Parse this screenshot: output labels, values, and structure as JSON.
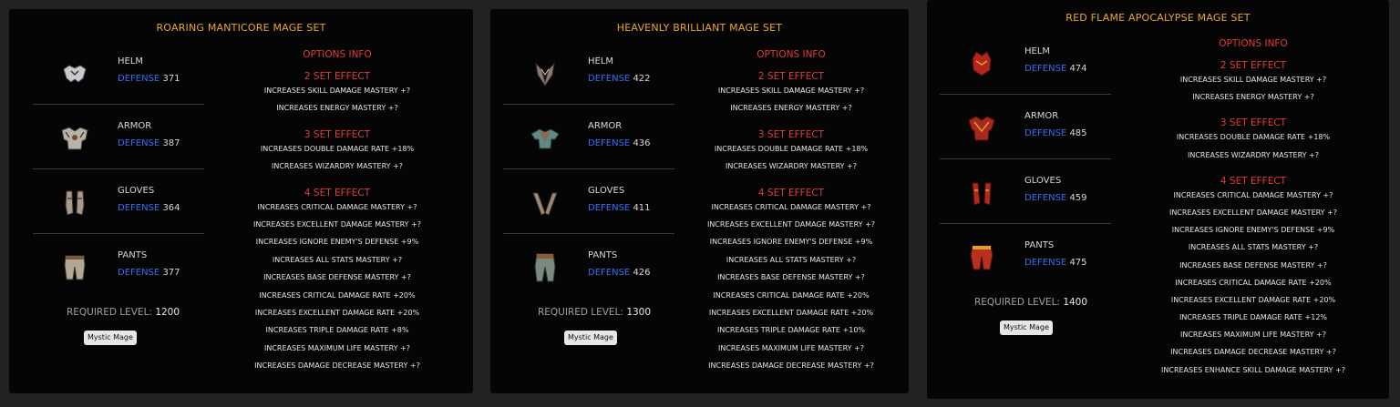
{
  "labels": {
    "options_info": "OPTIONS INFO",
    "defense": "DEFENSE",
    "required_level": "REQUIRED LEVEL:"
  },
  "sets": [
    {
      "title": "ROARING MANTICORE MAGE SET",
      "required_level": "1200",
      "class_tag": "Mystic Mage",
      "items": [
        {
          "name": "HELM",
          "defense": "371"
        },
        {
          "name": "ARMOR",
          "defense": "387"
        },
        {
          "name": "GLOVES",
          "defense": "364"
        },
        {
          "name": "PANTS",
          "defense": "377"
        }
      ],
      "effects": {
        "set2_title": "2 SET EFFECT",
        "set2": [
          "INCREASES SKILL DAMAGE MASTERY +?",
          "INCREASES ENERGY MASTERY +?"
        ],
        "set3_title": "3 SET EFFECT",
        "set3": [
          "INCREASES DOUBLE DAMAGE RATE +18%",
          "INCREASES WIZARDRY MASTERY +?"
        ],
        "set4_title": "4 SET EFFECT",
        "set4": [
          "INCREASES CRITICAL DAMAGE MASTERY +?",
          "INCREASES EXCELLENT DAMAGE MASTERY +?",
          "INCREASES IGNORE ENEMY'S DEFENSE +9%",
          "INCREASES ALL STATS MASTERY +?",
          "INCREASES BASE DEFENSE MASTERY +?",
          "INCREASES CRITICAL DAMAGE RATE +20%",
          "INCREASES EXCELLENT DAMAGE RATE +20%",
          "INCREASES TRIPLE DAMAGE RATE +8%",
          "INCREASES MAXIMUM LIFE MASTERY +?",
          "INCREASES DAMAGE DECREASE MASTERY +?"
        ]
      }
    },
    {
      "title": "HEAVENLY BRILLIANT MAGE SET",
      "required_level": "1300",
      "class_tag": "Mystic Mage",
      "items": [
        {
          "name": "HELM",
          "defense": "422"
        },
        {
          "name": "ARMOR",
          "defense": "436"
        },
        {
          "name": "GLOVES",
          "defense": "411"
        },
        {
          "name": "PANTS",
          "defense": "426"
        }
      ],
      "effects": {
        "set2_title": "2 SET EFFECT",
        "set2": [
          "INCREASES SKILL DAMAGE MASTERY +?",
          "INCREASES ENERGY MASTERY +?"
        ],
        "set3_title": "3 SET EFFECT",
        "set3": [
          "INCREASES DOUBLE DAMAGE RATE +18%",
          "INCREASES WIZARDRY MASTERY +?"
        ],
        "set4_title": "4 SET EFFECT",
        "set4": [
          "INCREASES CRITICAL DAMAGE MASTERY +?",
          "INCREASES EXCELLENT DAMAGE MASTERY +?",
          "INCREASES IGNORE ENEMY'S DEFENSE +9%",
          "INCREASES ALL STATS MASTERY +?",
          "INCREASES BASE DEFENSE MASTERY +?",
          "INCREASES CRITICAL DAMAGE RATE +20%",
          "INCREASES EXCELLENT DAMAGE RATE +20%",
          "INCREASES TRIPLE DAMAGE RATE +10%",
          "INCREASES MAXIMUM LIFE MASTERY +?",
          "INCREASES DAMAGE DECREASE MASTERY +?"
        ]
      }
    },
    {
      "title": "RED FLAME APOCALYPSE MAGE SET",
      "required_level": "1400",
      "class_tag": "Mystic Mage",
      "items": [
        {
          "name": "HELM",
          "defense": "474"
        },
        {
          "name": "ARMOR",
          "defense": "485"
        },
        {
          "name": "GLOVES",
          "defense": "459"
        },
        {
          "name": "PANTS",
          "defense": "475"
        }
      ],
      "effects": {
        "set2_title": "2 SET EFFECT",
        "set2": [
          "INCREASES SKILL DAMAGE MASTERY +?",
          "INCREASES ENERGY MASTERY +?"
        ],
        "set3_title": "3 SET EFFECT",
        "set3": [
          "INCREASES DOUBLE DAMAGE RATE +18%",
          "INCREASES WIZARDRY MASTERY +?"
        ],
        "set4_title": "4 SET EFFECT",
        "set4": [
          "INCREASES CRITICAL DAMAGE MASTERY +?",
          "INCREASES EXCELLENT DAMAGE MASTERY +?",
          "INCREASES IGNORE ENEMY'S DEFENSE +9%",
          "INCREASES ALL STATS MASTERY +?",
          "INCREASES BASE DEFENSE MASTERY +?",
          "INCREASES CRITICAL DAMAGE RATE +20%",
          "INCREASES EXCELLENT DAMAGE RATE +20%",
          "INCREASES TRIPLE DAMAGE RATE +12%",
          "INCREASES MAXIMUM LIFE MASTERY +?",
          "INCREASES DAMAGE DECREASE MASTERY +?",
          "INCREASES ENHANCE SKILL DAMAGE MASTERY +?"
        ]
      }
    }
  ]
}
